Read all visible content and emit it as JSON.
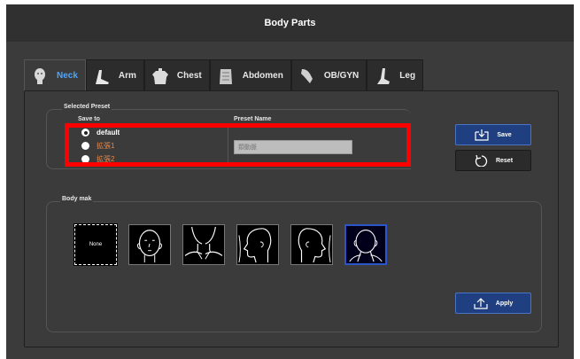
{
  "window": {
    "title": "Body Parts"
  },
  "tabs": [
    {
      "label": "Neck",
      "icon": "neck-icon",
      "active": true
    },
    {
      "label": "Arm",
      "icon": "arm-icon",
      "active": false
    },
    {
      "label": "Chest",
      "icon": "chest-icon",
      "active": false
    },
    {
      "label": "Abdomen",
      "icon": "abdomen-icon",
      "active": false
    },
    {
      "label": "OB/GYN",
      "icon": "obgyn-icon",
      "active": false
    },
    {
      "label": "Leg",
      "icon": "leg-icon",
      "active": false
    }
  ],
  "preset": {
    "group_label": "Selected Preset",
    "save_to_label": "Save to",
    "name_label": "Preset Name",
    "options": [
      {
        "label": "default",
        "checked": true
      },
      {
        "label": "拡張1",
        "checked": false
      },
      {
        "label": "拡張2",
        "checked": false
      }
    ],
    "name_placeholder": "頚動脈"
  },
  "buttons": {
    "save": "Save",
    "reset": "Reset",
    "apply": "Apply"
  },
  "body_mark": {
    "group_label": "Body mak",
    "none_label": "None",
    "thumbnails": [
      "none",
      "head-front",
      "neck-front",
      "head-right",
      "head-left",
      "head-back-selected"
    ]
  },
  "colors": {
    "accent": "#4da6ff",
    "highlight": "#ff0000",
    "primary_button": "#1f3f80"
  }
}
